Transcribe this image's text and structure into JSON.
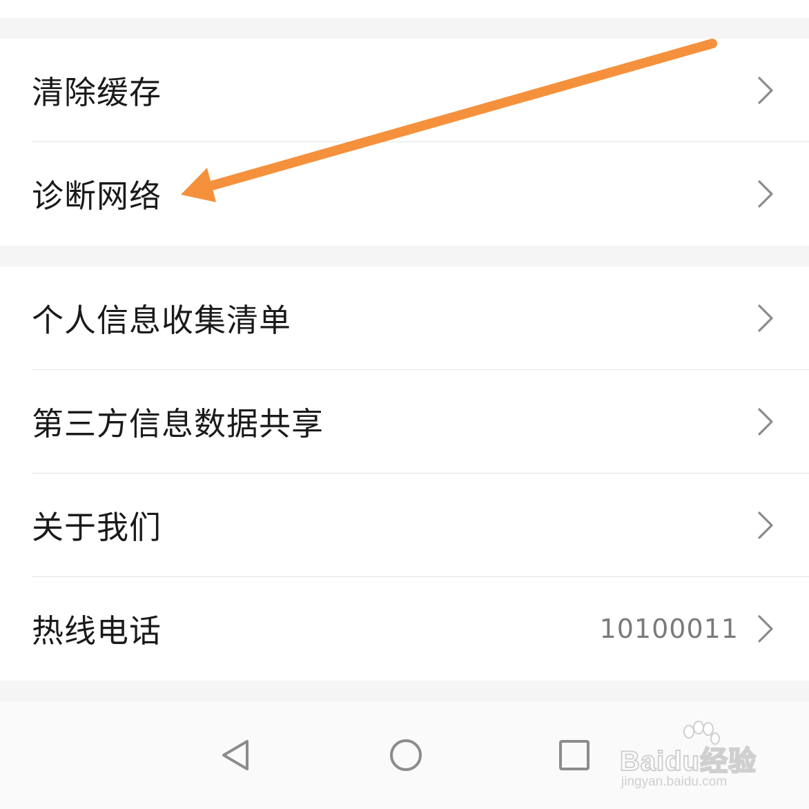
{
  "settings_group_1": {
    "items": [
      {
        "label": "清除缓存"
      },
      {
        "label": "诊断网络"
      }
    ]
  },
  "settings_group_2": {
    "items": [
      {
        "label": "个人信息收集清单"
      },
      {
        "label": "第三方信息数据共享"
      },
      {
        "label": "关于我们"
      },
      {
        "label": "热线电话",
        "value": "10100011"
      }
    ]
  },
  "annotation": {
    "arrow_color": "#f5913c",
    "points_to": "诊断网络"
  },
  "nav_bar": {
    "buttons": [
      "back-icon",
      "home-icon",
      "recent-apps-icon"
    ]
  },
  "watermark": {
    "brand": "Bai",
    "brand_suffix": "du",
    "product": "经验",
    "url": "jingyan.baidu.com"
  },
  "colors": {
    "text": "#1a1a1a",
    "secondary_text": "#7a7a7a",
    "chevron": "#8a8a8a",
    "background": "#f5f5f5",
    "divider": "#e2e2e2"
  }
}
